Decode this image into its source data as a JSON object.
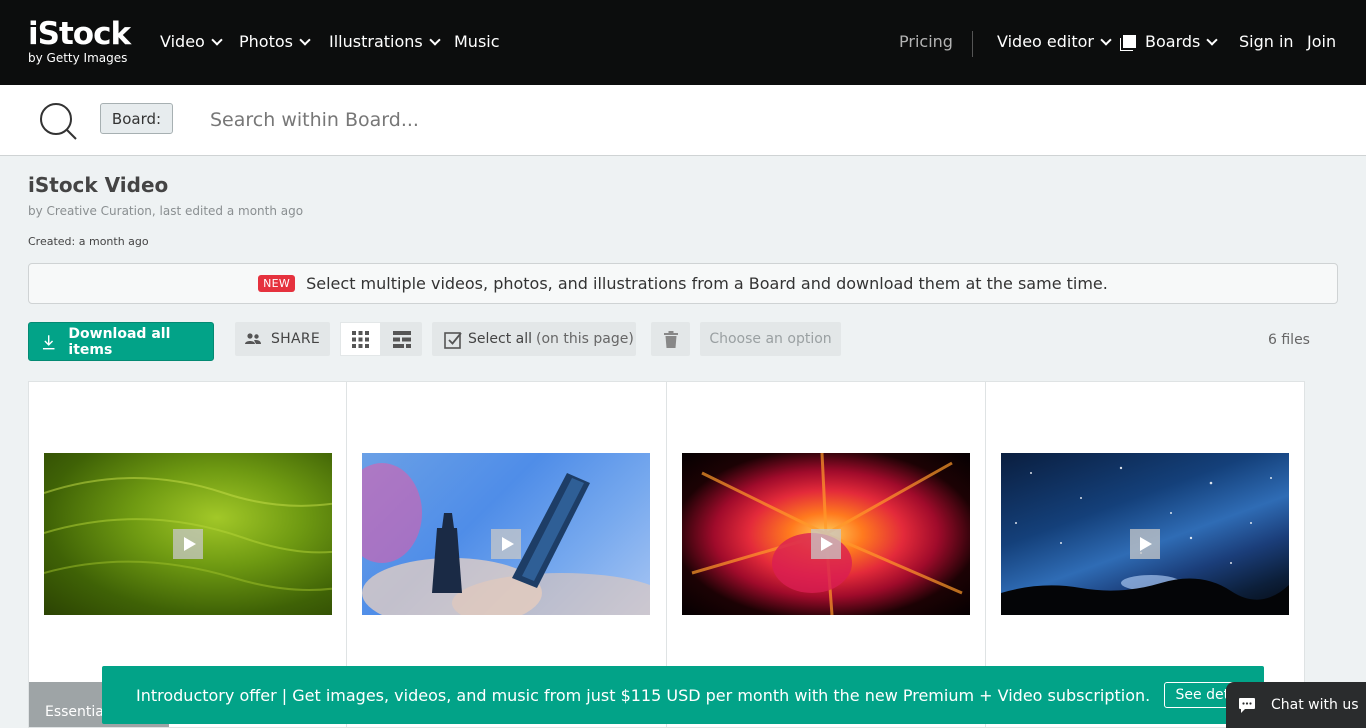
{
  "logo": {
    "main": "iStock",
    "sub": "by Getty Images"
  },
  "nav": {
    "video": "Video",
    "photos": "Photos",
    "illustrations": "Illustrations",
    "music": "Music",
    "pricing": "Pricing",
    "video_editor": "Video editor",
    "boards": "Boards",
    "sign_in": "Sign in",
    "join": "Join"
  },
  "search": {
    "chip": "Board:",
    "placeholder": "Search within Board..."
  },
  "board": {
    "title": "iStock Video",
    "meta": "by Creative Curation, last edited a month ago",
    "created": "Created: a month ago"
  },
  "banner": {
    "badge": "NEW",
    "text": "Select multiple videos, photos, and illustrations from a Board and download them at the same time."
  },
  "toolbar": {
    "download_all": "Download all items",
    "share": "SHARE",
    "select_all": "Select all",
    "select_all_suffix": "(on this page)",
    "choose_option": "Choose an option",
    "file_count": "6 files"
  },
  "cards": [
    {
      "tag": "Essentia"
    },
    {
      "tag": ""
    },
    {
      "tag": ""
    },
    {
      "tag": ""
    }
  ],
  "promo": {
    "text": "Introductory offer | Get images, videos, and music from just $115 USD per month with the new Premium + Video subscription.",
    "button": "See details"
  },
  "chat": {
    "label": "Chat with us"
  },
  "colors": {
    "brand_green": "#02a388",
    "nav_bg": "#0c0d0d",
    "new_badge": "#e5323e"
  }
}
